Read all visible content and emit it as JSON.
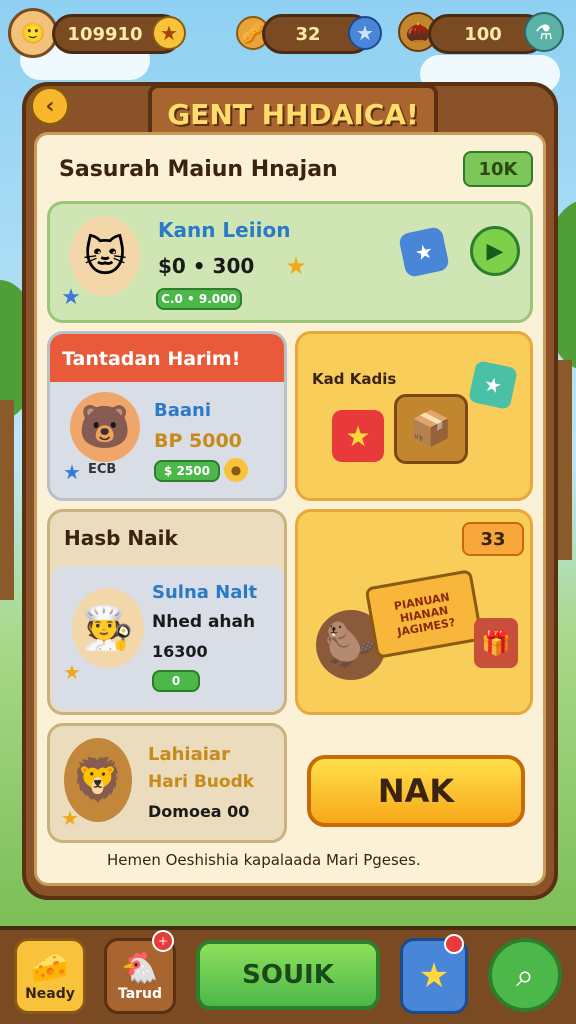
{
  "topbar": {
    "coins": "109910",
    "gems": "32",
    "food": "100",
    "icons": {
      "avatar": "player-avatar",
      "coin": "star-coin-icon",
      "nut": "nut-icon",
      "gem": "blue-star-icon",
      "leaf": "leaf-icon",
      "potion": "potion-icon"
    }
  },
  "panel": {
    "title": "GENT HHDAICA!",
    "subtitle": "Sasurah Maiun Hnajan",
    "badge": "10K"
  },
  "offer1": {
    "name": "Kann Leiion",
    "price": "$0 • 300",
    "tag": "C.0 • 9.000"
  },
  "offer2": {
    "header": "Tantadan Harim!",
    "name": "Baani",
    "price": "BP 5000",
    "tag": "$ 2500",
    "level": "ECB"
  },
  "offer3": {
    "label": "Kad Kadis"
  },
  "offer4": {
    "header": "Hasb Naik",
    "name": "Sulna Nalt",
    "sub": "Nhed ahah",
    "price": "16300",
    "tag": "0"
  },
  "offer5": {
    "badge": "33",
    "sign": "PIANUAN HIANAN JAGIMES?"
  },
  "offer6": {
    "name": "Lahiaiar",
    "sub": "Hari Buodk",
    "price": "Domoea 00"
  },
  "main_button": "NAK",
  "footer_text": "Hemen Oeshishia kapalaada Mari Pgeses.",
  "bottom_nav": [
    {
      "label": "Neady",
      "icon": "cheese-icon"
    },
    {
      "label": "Tarud",
      "icon": "chicken-icon"
    },
    {
      "label": "SOUIK"
    },
    {
      "label": "",
      "icon": "star-icon"
    },
    {
      "label": "",
      "icon": "search-icon"
    }
  ]
}
